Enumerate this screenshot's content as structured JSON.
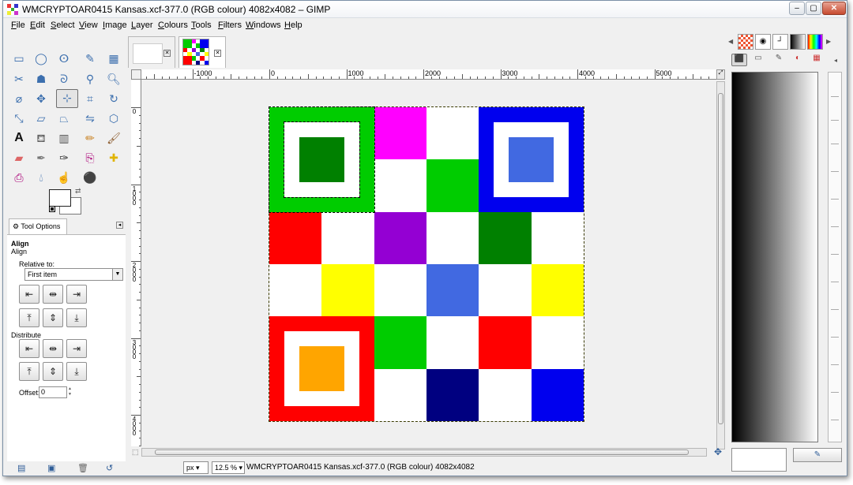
{
  "window": {
    "title": "WMCRYPTOAR0415 Kansas.xcf-377.0 (RGB colour) 4082x4082 – GIMP",
    "controls": {
      "minimize": "–",
      "maximize": "▢",
      "close": "✕"
    }
  },
  "menubar": {
    "items": [
      "File",
      "Edit",
      "Select",
      "View",
      "Image",
      "Layer",
      "Colours",
      "Tools",
      "Filters",
      "Windows",
      "Help"
    ]
  },
  "toolbox": {
    "tools": [
      [
        "rect-select-icon",
        "ellipse-select-icon",
        "free-select-icon",
        "fuzzy-select-icon",
        "select-by-color-icon"
      ],
      [
        "scissors-select-icon",
        "foreground-select-icon",
        "paths-icon",
        "color-picker-icon",
        "zoom-icon"
      ],
      [
        "measure-icon",
        "move-icon",
        "align-icon",
        "crop-icon",
        "rotate-icon"
      ],
      [
        "scale-icon",
        "shear-icon",
        "perspective-icon",
        "flip-icon",
        "cage-transform-icon"
      ],
      [
        "text-icon",
        "bucket-fill-icon",
        "blend-icon",
        "pencil-icon",
        "paintbrush-icon"
      ],
      [
        "eraser-icon",
        "airbrush-icon",
        "ink-icon",
        "clone-icon",
        "heal-icon"
      ],
      [
        "perspective-clone-icon",
        "blur-icon",
        "smudge-icon",
        "dodge-burn-icon",
        ""
      ]
    ],
    "active_tool": "align-icon"
  },
  "tool_options": {
    "tab_label": "Tool Options",
    "tool_name": "Align",
    "tool_subname": "Align",
    "relative_to_label": "Relative to:",
    "relative_to_value": "First item",
    "distribute_label": "Distribute",
    "offset_label": "Offset:",
    "offset_value": "0"
  },
  "canvas": {
    "ruler_h_labels": [
      "-1000",
      "0",
      "1000",
      "2000",
      "3000",
      "4000",
      "5000"
    ],
    "ruler_v_labels": [
      "0",
      "1000",
      "2000",
      "3000",
      "4000"
    ],
    "grid_colors": [
      [
        "#00cc00",
        "#00cc00",
        "#ff00ff",
        "#ffffff",
        "#0000ee",
        "#0000ee"
      ],
      [
        "#00cc00",
        "#00cc00",
        "#ffffff",
        "#00cc00",
        "#0000ee",
        "#0000ee"
      ],
      [
        "#ff0000",
        "#ffffff",
        "#9400d3",
        "#ffffff",
        "#008000",
        "#ffffff"
      ],
      [
        "#ffffff",
        "#ffff00",
        "#ffffff",
        "#4169e1",
        "#ffffff",
        "#ffff00"
      ],
      [
        "#ff0000",
        "#ff0000",
        "#00cc00",
        "#ffffff",
        "#ff0000",
        "#ffffff"
      ],
      [
        "#ff0000",
        "#ff0000",
        "#ffffff",
        "#000080",
        "#ffffff",
        "#0000ee"
      ]
    ],
    "corners": {
      "top_left": {
        "outer": "#00cc00",
        "inner": "#008000"
      },
      "top_right": {
        "outer": "#0000ee",
        "inner": "#4169e1"
      },
      "bottom_left": {
        "outer": "#ff0000",
        "inner": "#ffa500"
      }
    }
  },
  "statusbar": {
    "unit": "px",
    "zoom": "12.5 %",
    "info": "WMCRYPTOAR0415 Kansas.xcf-377.0 (RGB colour) 4082x4082"
  }
}
